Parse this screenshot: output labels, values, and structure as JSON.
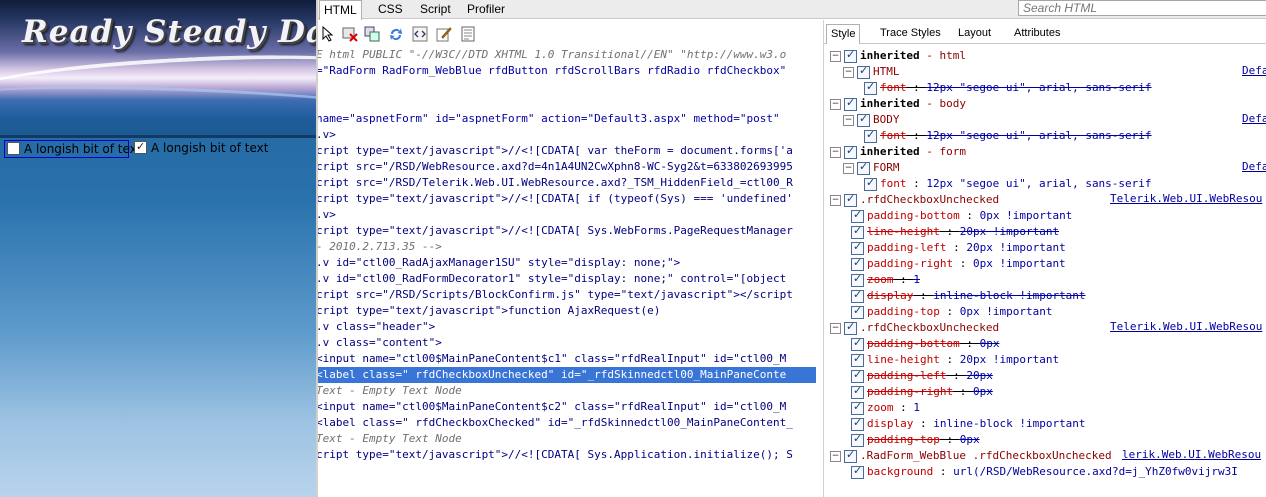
{
  "left_page": {
    "banner_title": "Ready Steady Da",
    "checkbox1_label": "A longish bit of text",
    "checkbox2_label": "A longish bit of text"
  },
  "firebug": {
    "tabs": [
      "HTML",
      "CSS",
      "Script",
      "Profiler"
    ],
    "search_placeholder": "Search HTML",
    "side_tabs": [
      "Style",
      "Trace Styles",
      "Layout",
      "Attributes"
    ],
    "code_lines": [
      {
        "type": "cm",
        "text": "E html PUBLIC \"-//W3C//DTD XHTML 1.0 Transitional//EN\" \"http://www.w3.o"
      },
      {
        "type": "attr",
        "text": "=\"RadForm RadForm_WebBlue rfdButton rfdScrollBars rfdRadio rfdCheckbox\""
      },
      {
        "type": "blank",
        "text": ""
      },
      {
        "type": "blank",
        "text": ""
      },
      {
        "type": "attr",
        "text": " name=\"aspnetForm\" id=\"aspnetForm\" action=\"Default3.aspx\" method=\"post\""
      },
      {
        "type": "tag",
        "text": ".v>"
      },
      {
        "type": "tag",
        "text": "cript type=\"text/javascript\">//<![CDATA[ var theForm = document.forms['a"
      },
      {
        "type": "tag",
        "text": "cript src=\"/RSD/WebResource.axd?d=4n1A4UN2CwXphn8-WC-Syg2&t=633802693995"
      },
      {
        "type": "tag",
        "text": "cript src=\"/RSD/Telerik.Web.UI.WebResource.axd?_TSM_HiddenField_=ctl00_R"
      },
      {
        "type": "tag",
        "text": "cript type=\"text/javascript\">//<![CDATA[ if (typeof(Sys) === 'undefined'"
      },
      {
        "type": "tag",
        "text": ".v>"
      },
      {
        "type": "tag",
        "text": "cript type=\"text/javascript\">//<![CDATA[ Sys.WebForms.PageRequestManager"
      },
      {
        "type": "cm",
        "text": "-  2010.2.713.35  -->"
      },
      {
        "type": "tag",
        "text": ".v id=\"ctl00_RadAjaxManager1SU\" style=\"display: none;\">"
      },
      {
        "type": "tag",
        "text": ".v id=\"ctl00_RadFormDecorator1\" style=\"display: none;\" control=\"[object"
      },
      {
        "type": "tag",
        "text": "cript src=\"/RSD/Scripts/BlockConfirm.js\" type=\"text/javascript\"></script"
      },
      {
        "type": "tag",
        "text": "cript type=\"text/javascript\">function AjaxRequest(e)"
      },
      {
        "type": "tag",
        "text": ".v class=\"header\">"
      },
      {
        "type": "tag",
        "text": ".v class=\"content\">"
      },
      {
        "type": "tag",
        "text": "<input name=\"ctl00$MainPaneContent$c1\" class=\"rfdRealInput\" id=\"ctl00_M"
      },
      {
        "type": "sel",
        "text": "<label class=\" rfdCheckboxUnchecked\" id=\"_rfdSkinnedctl00_MainPaneConte"
      },
      {
        "type": "cm",
        "text": "Text - Empty Text Node"
      },
      {
        "type": "tag",
        "text": "<input name=\"ctl00$MainPaneContent$c2\" class=\"rfdRealInput\" id=\"ctl00_M"
      },
      {
        "type": "tag",
        "text": "<label class=\" rfdCheckboxChecked\" id=\"_rfdSkinnedctl00_MainPaneContent_"
      },
      {
        "type": "cm",
        "text": "Text - Empty Text Node"
      },
      {
        "type": "tag",
        "text": "cript type=\"text/javascript\">//<![CDATA[ Sys.Application.initialize(); S"
      }
    ],
    "style_rows": [
      {
        "kind": "inherited",
        "indent": 0,
        "toggle": "⊟",
        "text": "inherited",
        "extra": "html"
      },
      {
        "kind": "selector",
        "indent": 1,
        "toggle": "⊟",
        "text": "HTML",
        "src": "Defa"
      },
      {
        "kind": "prop",
        "indent": 2,
        "name": "font",
        "value": "12px \"segoe ui\", arial, sans-serif",
        "struck": true
      },
      {
        "kind": "inherited",
        "indent": 0,
        "toggle": "⊟",
        "text": "inherited",
        "extra": "body"
      },
      {
        "kind": "selector",
        "indent": 1,
        "toggle": "⊟",
        "text": "BODY",
        "src": "Defa"
      },
      {
        "kind": "prop",
        "indent": 2,
        "name": "font",
        "value": "12px \"segoe ui\", arial, sans-serif",
        "struck": true
      },
      {
        "kind": "inherited",
        "indent": 0,
        "toggle": "⊟",
        "text": "inherited",
        "extra": "form"
      },
      {
        "kind": "selector",
        "indent": 1,
        "toggle": "⊟",
        "text": "FORM",
        "src": "Defa"
      },
      {
        "kind": "prop",
        "indent": 2,
        "name": "font",
        "value": "12px \"segoe ui\", arial, sans-serif",
        "struck": false
      },
      {
        "kind": "rule",
        "indent": 0,
        "toggle": "⊟",
        "text": ".rfdCheckboxUnchecked",
        "src": "Telerik.Web.UI.WebResou"
      },
      {
        "kind": "prop",
        "indent": 1,
        "name": "padding-bottom",
        "value": "0px !important",
        "struck": false
      },
      {
        "kind": "prop",
        "indent": 1,
        "name": "line-height",
        "value": "20px !important",
        "struck": true
      },
      {
        "kind": "prop",
        "indent": 1,
        "name": "padding-left",
        "value": "20px !important",
        "struck": false
      },
      {
        "kind": "prop",
        "indent": 1,
        "name": "padding-right",
        "value": "0px !important",
        "struck": false
      },
      {
        "kind": "prop",
        "indent": 1,
        "name": "zoom",
        "value": "1",
        "struck": true
      },
      {
        "kind": "prop",
        "indent": 1,
        "name": "display",
        "value": "inline-block !important",
        "struck": true
      },
      {
        "kind": "prop",
        "indent": 1,
        "name": "padding-top",
        "value": "0px !important",
        "struck": false
      },
      {
        "kind": "rule",
        "indent": 0,
        "toggle": "⊟",
        "text": ".rfdCheckboxUnchecked",
        "src": "Telerik.Web.UI.WebResou"
      },
      {
        "kind": "prop",
        "indent": 1,
        "name": "padding-bottom",
        "value": "0px",
        "struck": true
      },
      {
        "kind": "prop",
        "indent": 1,
        "name": "line-height",
        "value": "20px !important",
        "struck": false
      },
      {
        "kind": "prop",
        "indent": 1,
        "name": "padding-left",
        "value": "20px",
        "struck": true
      },
      {
        "kind": "prop",
        "indent": 1,
        "name": "padding-right",
        "value": "0px",
        "struck": true
      },
      {
        "kind": "prop",
        "indent": 1,
        "name": "zoom",
        "value": "1",
        "struck": false
      },
      {
        "kind": "prop",
        "indent": 1,
        "name": "display",
        "value": "inline-block !important",
        "struck": false
      },
      {
        "kind": "prop",
        "indent": 1,
        "name": "padding-top",
        "value": "0px",
        "struck": true
      },
      {
        "kind": "rule",
        "indent": 0,
        "toggle": "⊟",
        "text": ".RadForm_WebBlue .rfdCheckboxUnchecked",
        "src": "lerik.Web.UI.WebResou"
      },
      {
        "kind": "prop",
        "indent": 1,
        "name": "background",
        "value": "url(/RSD/WebResource.axd?d=j_YhZ0fw0vijrw3I",
        "struck": false
      }
    ]
  }
}
